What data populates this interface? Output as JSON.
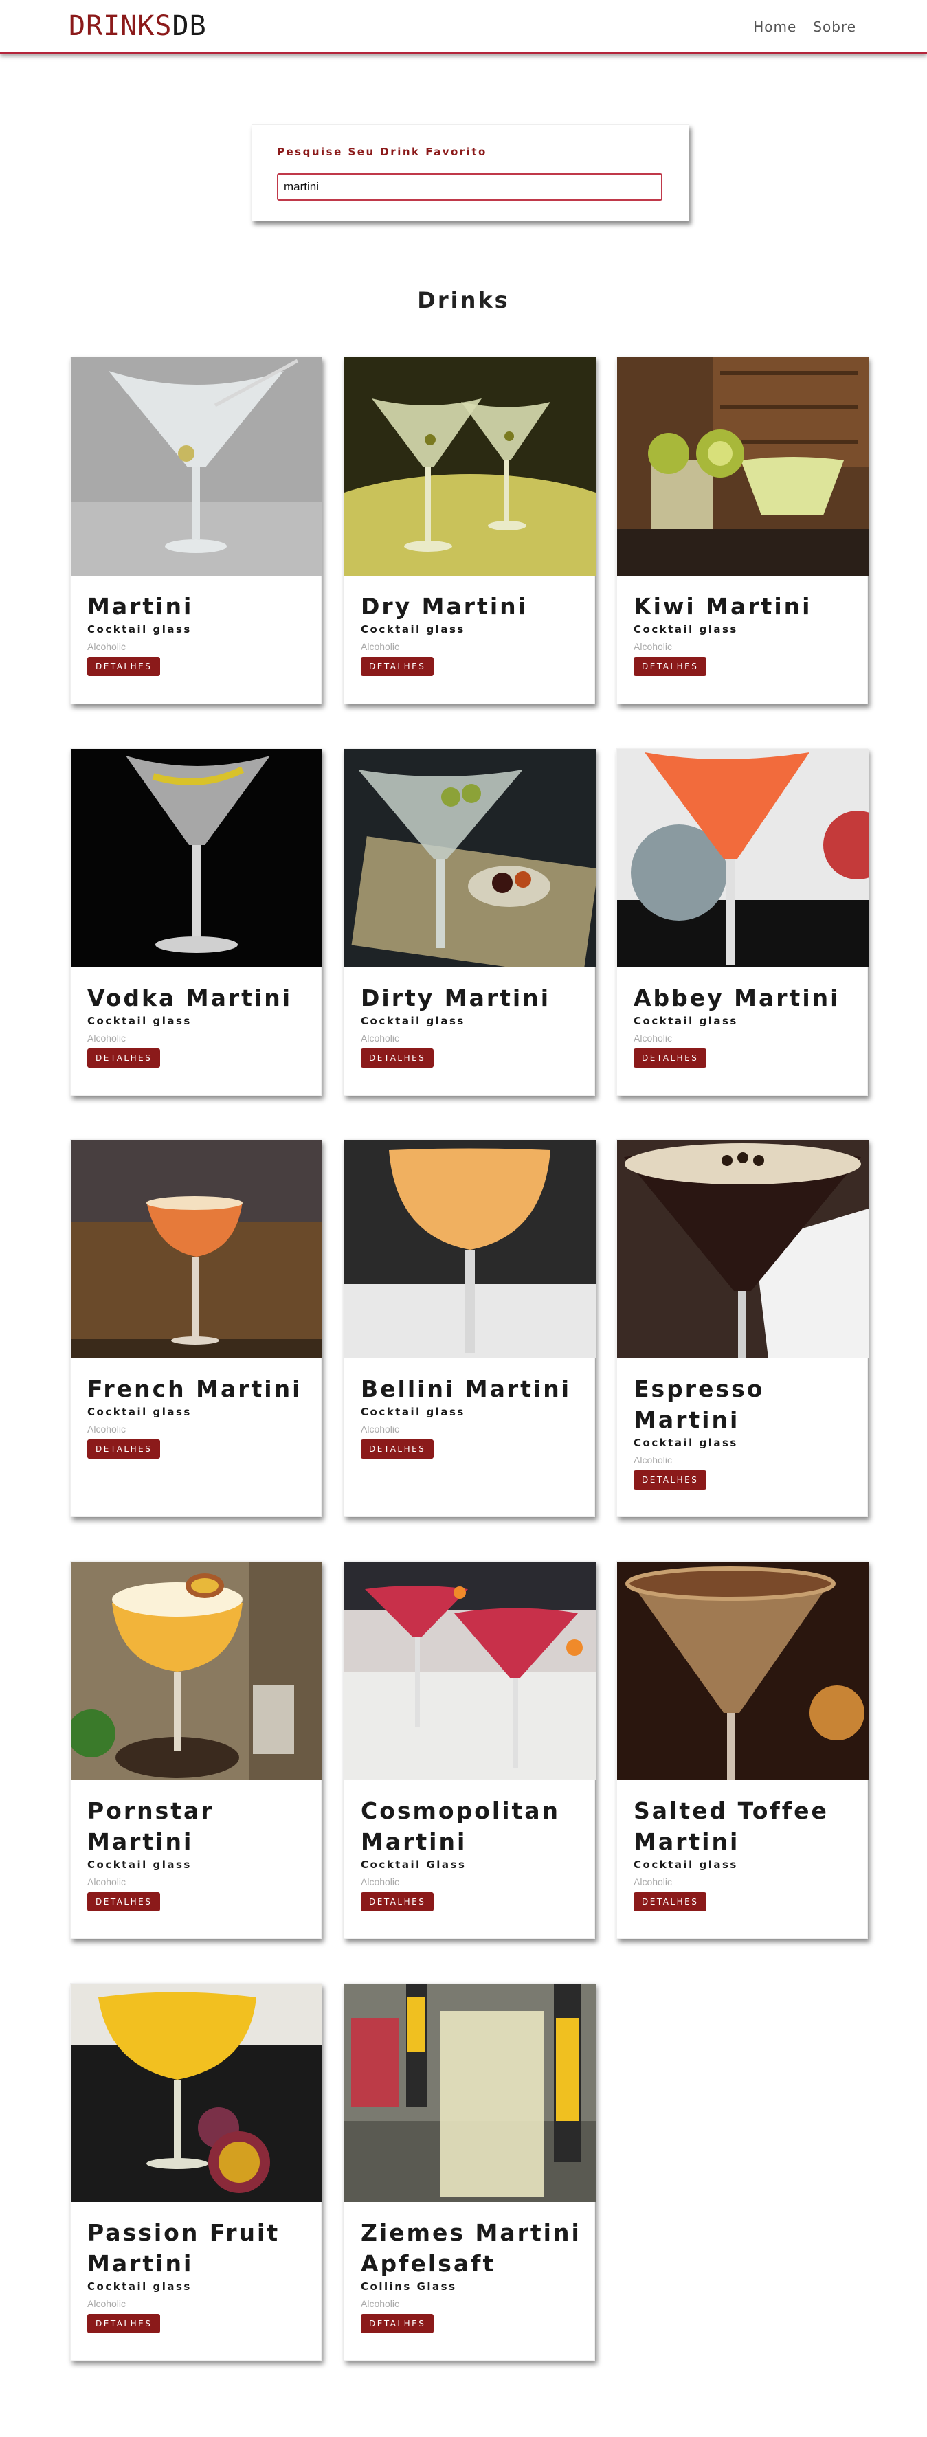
{
  "navbar": {
    "brand_part1": "DRINKS",
    "brand_part2": "DB",
    "links": [
      "Home",
      "Sobre"
    ]
  },
  "search": {
    "label": "Pesquise Seu Drink Favorito",
    "value": "martini"
  },
  "section_title": "Drinks",
  "colors": {
    "brand_red": "#8b1a1a",
    "navbar_border": "#b3243a",
    "button_bg": "#8b1a1a"
  },
  "drinks": [
    {
      "name": "Martini",
      "glass": "Cocktail glass",
      "type": "Alcoholic",
      "button": "DETALHES",
      "image": "martini-photo"
    },
    {
      "name": "Dry Martini",
      "glass": "Cocktail glass",
      "type": "Alcoholic",
      "button": "DETALHES",
      "image": "dry-martini-photo"
    },
    {
      "name": "Kiwi Martini",
      "glass": "Cocktail glass",
      "type": "Alcoholic",
      "button": "DETALHES",
      "image": "kiwi-martini-photo"
    },
    {
      "name": "Vodka Martini",
      "glass": "Cocktail glass",
      "type": "Alcoholic",
      "button": "DETALHES",
      "image": "vodka-martini-photo"
    },
    {
      "name": "Dirty Martini",
      "glass": "Cocktail glass",
      "type": "Alcoholic",
      "button": "DETALHES",
      "image": "dirty-martini-photo"
    },
    {
      "name": "Abbey Martini",
      "glass": "Cocktail glass",
      "type": "Alcoholic",
      "button": "DETALHES",
      "image": "abbey-martini-photo"
    },
    {
      "name": "French Martini",
      "glass": "Cocktail glass",
      "type": "Alcoholic",
      "button": "DETALHES",
      "image": "french-martini-photo"
    },
    {
      "name": "Bellini Martini",
      "glass": "Cocktail glass",
      "type": "Alcoholic",
      "button": "DETALHES",
      "image": "bellini-martini-photo"
    },
    {
      "name": "Espresso Martini",
      "glass": "Cocktail glass",
      "type": "Alcoholic",
      "button": "DETALHES",
      "image": "espresso-martini-photo"
    },
    {
      "name": "Pornstar Martini",
      "glass": "Cocktail glass",
      "type": "Alcoholic",
      "button": "DETALHES",
      "image": "pornstar-martini-photo"
    },
    {
      "name": "Cosmopolitan Martini",
      "glass": "Cocktail Glass",
      "type": "Alcoholic",
      "button": "DETALHES",
      "image": "cosmopolitan-martini-photo"
    },
    {
      "name": "Salted Toffee Martini",
      "glass": "Cocktail glass",
      "type": "Alcoholic",
      "button": "DETALHES",
      "image": "salted-toffee-martini-photo"
    },
    {
      "name": "Passion Fruit Martini",
      "glass": "Cocktail glass",
      "type": "Alcoholic",
      "button": "DETALHES",
      "image": "passion-fruit-martini-photo"
    },
    {
      "name": "Ziemes Martini Apfelsaft",
      "glass": "Collins Glass",
      "type": "Alcoholic",
      "button": "DETALHES",
      "image": "ziemes-martini-apfelsaft-photo"
    }
  ]
}
